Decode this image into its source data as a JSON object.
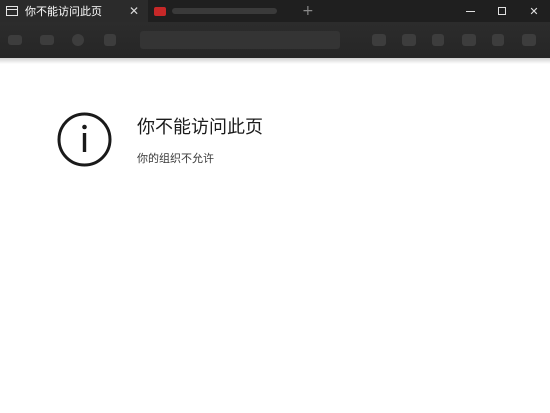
{
  "tabs": [
    {
      "title": "你不能访问此页",
      "active": true,
      "icon": "page-icon"
    },
    {
      "title": "",
      "active": false,
      "icon": "red-favicon-icon"
    }
  ],
  "tab_close_glyph": "✕",
  "new_tab_glyph": "+",
  "window_controls": {
    "close_glyph": "✕"
  },
  "error": {
    "title": "你不能访问此页",
    "subtitle": "你的组织不允许",
    "icon": "info-icon"
  },
  "colors": {
    "titlebar": "#1f1f1f",
    "active_tab": "#2b2b2b",
    "toolbar": "#2a2a2a",
    "page_bg": "#ffffff",
    "title_text": "#1b1b1b"
  }
}
